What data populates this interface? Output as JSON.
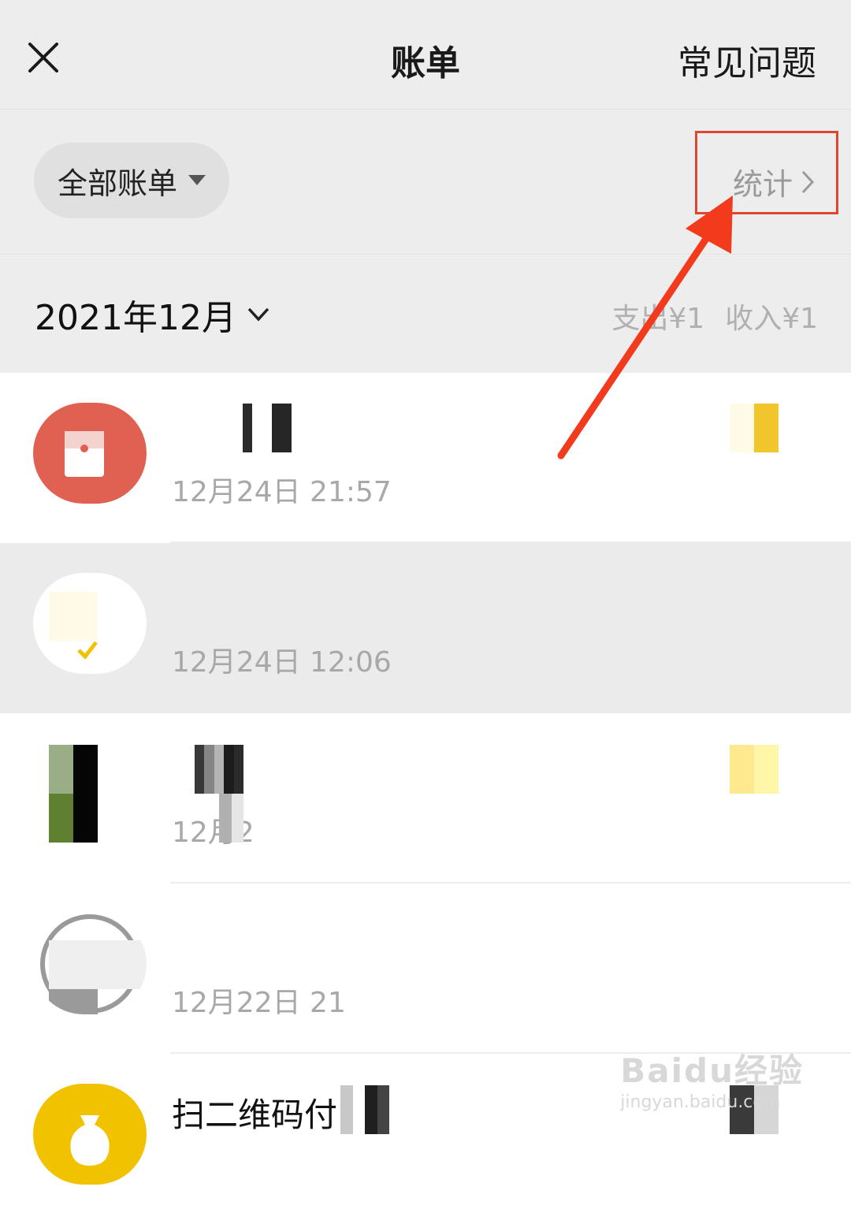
{
  "header": {
    "title": "账单",
    "faq": "常见问题"
  },
  "filter": {
    "label": "全部账单",
    "stats": "统计"
  },
  "month": {
    "label": "2021年12月",
    "expense": "支出¥1",
    "income": "收入¥1"
  },
  "list": {
    "items": [
      {
        "time": "12月24日 21:57",
        "icon": "red-packet-icon"
      },
      {
        "time": "12月24日 12:06",
        "icon": "wallet-icon"
      },
      {
        "time": "12月2",
        "icon": "merchant-avatar"
      },
      {
        "time": "12月22日 21",
        "icon": "merchant-avatar"
      },
      {
        "title": "扫二维码付",
        "icon": "moneybag-icon"
      }
    ]
  },
  "watermark": {
    "brand": "Baidu经验",
    "url": "jingyan.baidu.com"
  },
  "colors": {
    "accent_red": "#e0452e",
    "red_packet": "#e06152",
    "yellow": "#f0c200"
  }
}
